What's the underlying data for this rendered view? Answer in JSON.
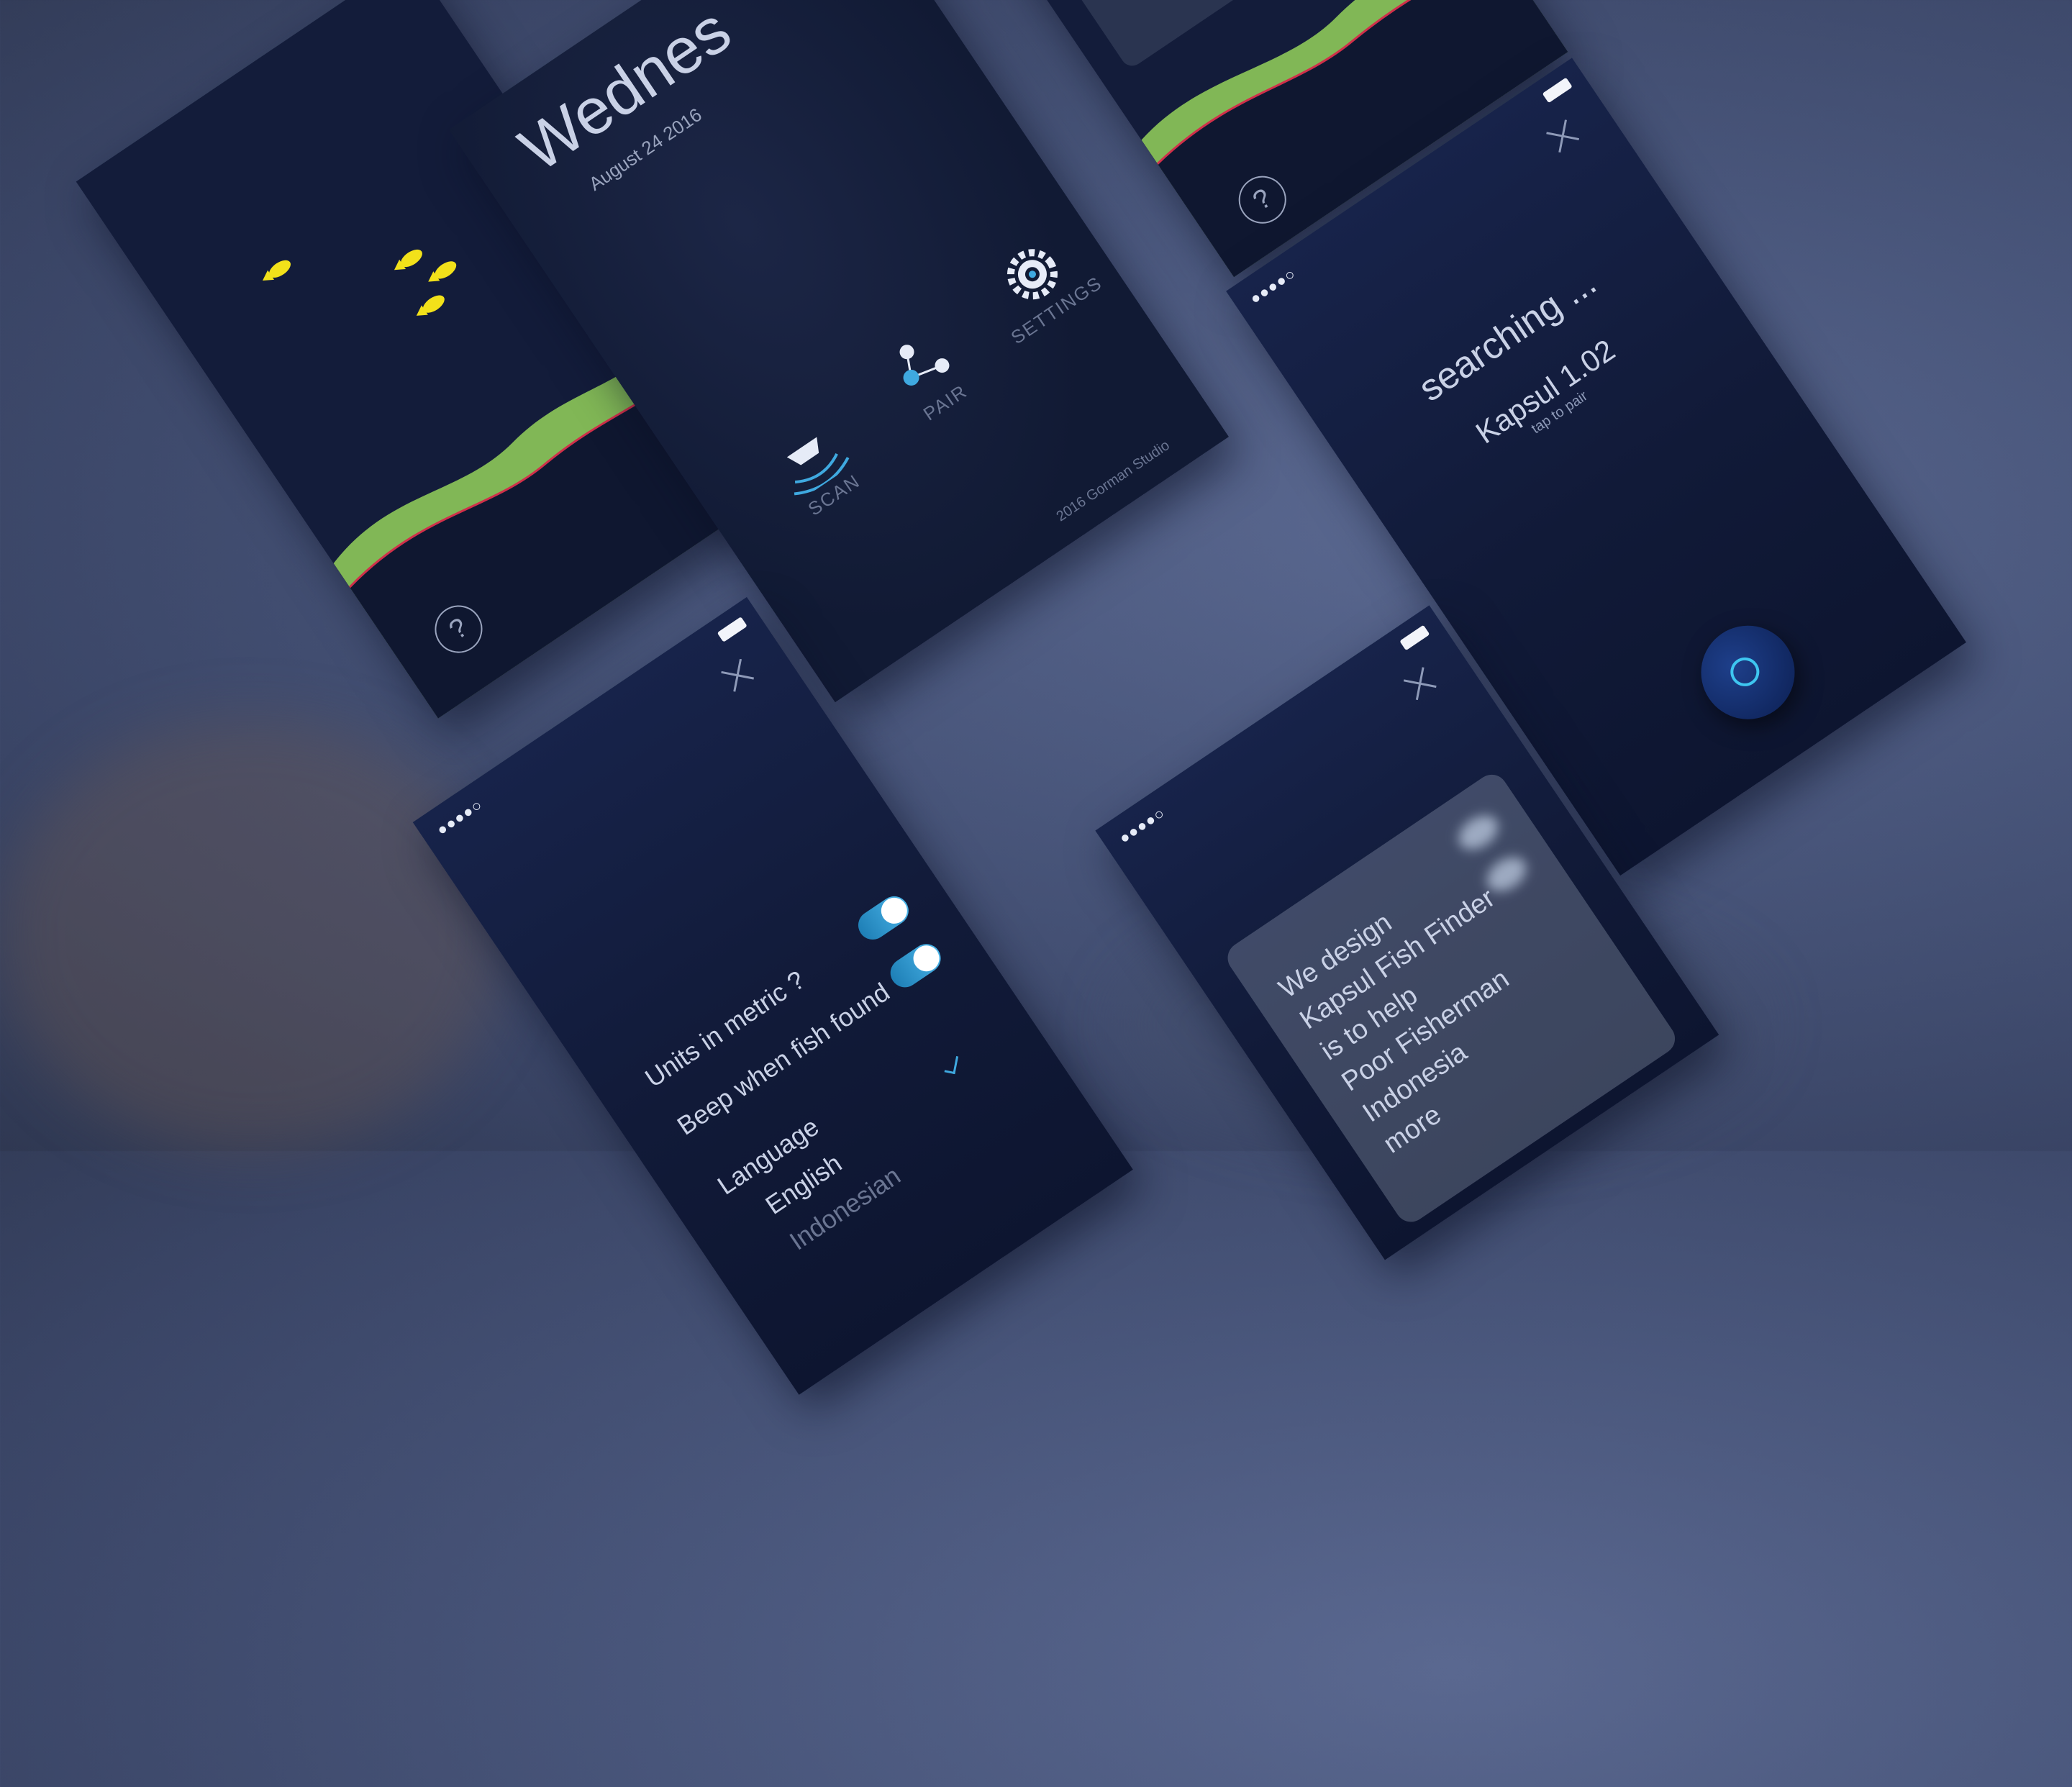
{
  "colors": {
    "background": "#48557a",
    "screen": "#0f1935",
    "accent": "#3fa9e0",
    "terrain": "#8ec95a",
    "bottom_line": "#d0304a",
    "fish": "#f2e11a",
    "record": "#e01e2e"
  },
  "home": {
    "day": "Wednes",
    "date": "August 24 2016",
    "menu": [
      {
        "label": "SCAN",
        "icon": "sonar-boat-icon"
      },
      {
        "label": "PAIR",
        "icon": "pair-nodes-icon"
      },
      {
        "label": "SETTINGS",
        "icon": "gear-icon"
      }
    ],
    "footer": "2016 Gorman Studio"
  },
  "settings": {
    "status": "●●●●○",
    "options": [
      {
        "label": "Units in metric ?",
        "enabled": true
      },
      {
        "label": "Beep when fish found",
        "enabled": true
      }
    ],
    "language_label": "Language",
    "languages": [
      "English",
      "Indonesian"
    ],
    "selected_language": "English"
  },
  "search": {
    "status": "●●●●○",
    "title": "searching ...",
    "device": "Kapsul 1.02",
    "device_hint": "tap to pair",
    "scan_button_icon": "ring-icon"
  },
  "about": {
    "status": "●●●●○",
    "lines": [
      "We design",
      "Kapsul Fish Finder",
      "is to help",
      "Poor Fisherman",
      "Indonesia",
      "more"
    ],
    "brand": "Kapsul"
  },
  "sonar": {
    "help_icon": "help-icon"
  }
}
